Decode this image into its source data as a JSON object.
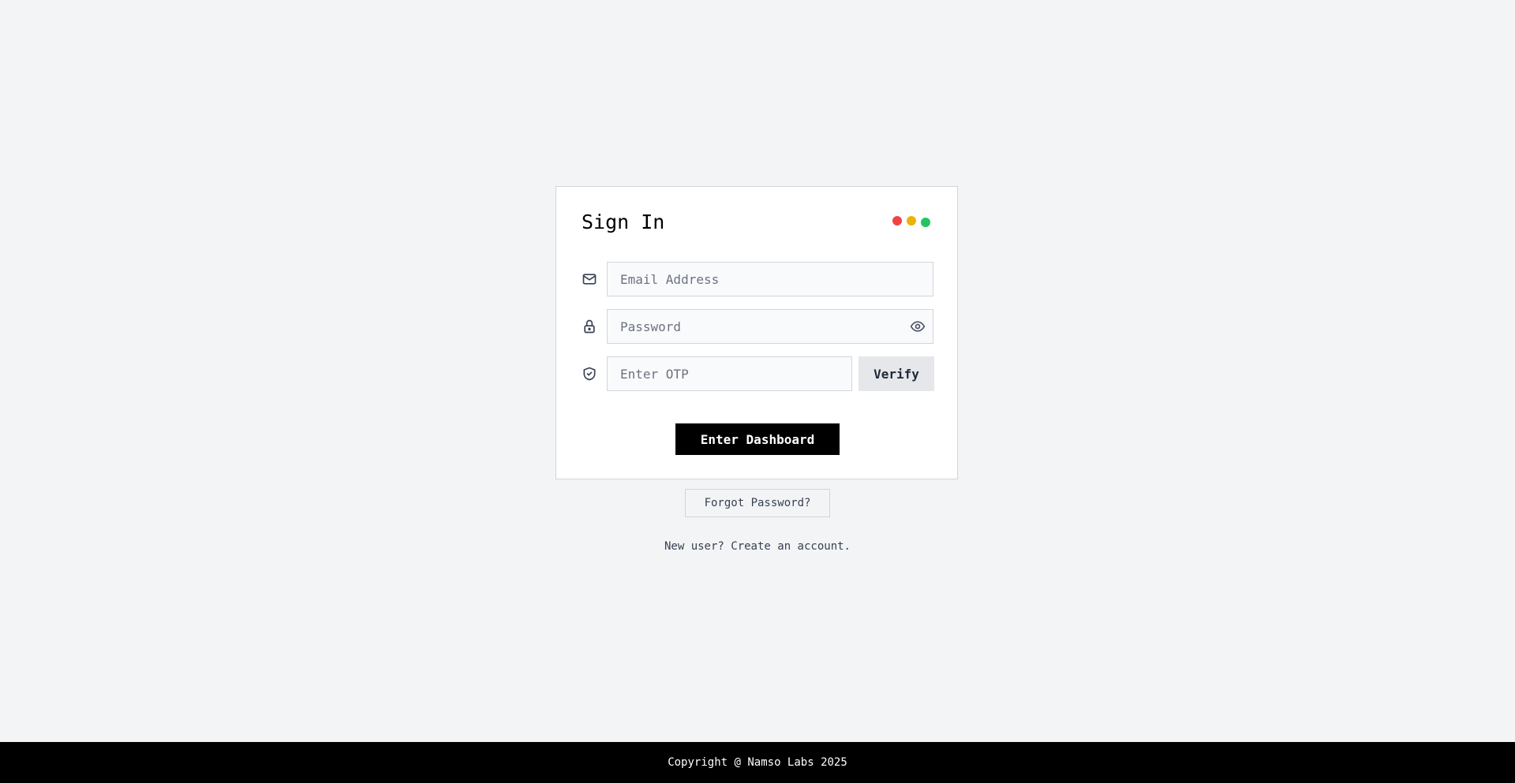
{
  "signin": {
    "title": "Sign In",
    "window_dots": [
      "#ef4444",
      "#eab308",
      "#22c55e"
    ],
    "email": {
      "placeholder": "Email Address",
      "value": "",
      "icon": "mail-icon"
    },
    "password": {
      "placeholder": "Password",
      "value": "",
      "icon": "lock-icon",
      "toggle_icon": "eye-icon"
    },
    "otp": {
      "placeholder": "Enter OTP",
      "value": "",
      "icon": "shield-check-icon",
      "verify_label": "Verify"
    },
    "submit_label": "Enter Dashboard"
  },
  "links": {
    "forgot_password": "Forgot Password?",
    "signup": "New user? Create an account."
  },
  "footer": {
    "copyright": "Copyright @ Namso Labs 2025"
  }
}
